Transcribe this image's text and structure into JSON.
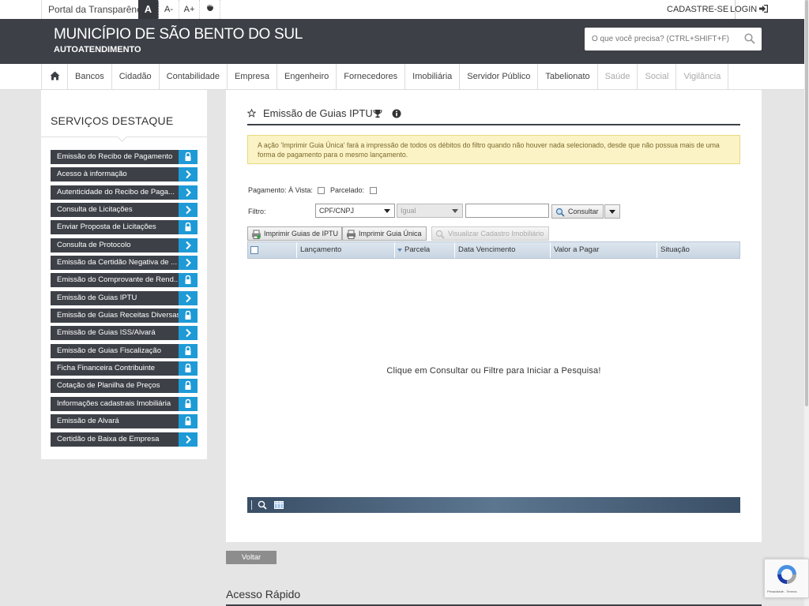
{
  "topbar": {
    "portal_label": "Portal da Transparência",
    "font_normal": "A",
    "font_decrease": "A-",
    "font_increase": "A+",
    "signup_label": "CADASTRE-SE",
    "login_label": "LOGIN"
  },
  "header": {
    "title": "MUNICÍPIO DE SÃO BENTO DO SUL",
    "subtitle": "AUTOATENDIMENTO",
    "search_placeholder": "O que você precisa? (CTRL+SHIFT+F)"
  },
  "nav": {
    "items": [
      {
        "label": "Bancos",
        "enabled": true
      },
      {
        "label": "Cidadão",
        "enabled": true
      },
      {
        "label": "Contabilidade",
        "enabled": true
      },
      {
        "label": "Empresa",
        "enabled": true
      },
      {
        "label": "Engenheiro",
        "enabled": true
      },
      {
        "label": "Fornecedores",
        "enabled": true
      },
      {
        "label": "Imobiliária",
        "enabled": true
      },
      {
        "label": "Servidor Público",
        "enabled": true
      },
      {
        "label": "Tabelionato",
        "enabled": true
      },
      {
        "label": "Saúde",
        "enabled": false
      },
      {
        "label": "Social",
        "enabled": false
      },
      {
        "label": "Vigilância",
        "enabled": false
      }
    ]
  },
  "sidebar": {
    "title": "SERVIÇOS DESTAQUE",
    "items": [
      {
        "label": "Emissão do Recibo de Pagamento",
        "icon": "lock-icon"
      },
      {
        "label": "Acesso à informação",
        "icon": "chevron-right-icon"
      },
      {
        "label": "Autenticidade do Recibo de Paga...",
        "icon": "chevron-right-icon"
      },
      {
        "label": "Consulta de Licitações",
        "icon": "chevron-right-icon"
      },
      {
        "label": "Enviar Proposta de Licitações",
        "icon": "lock-icon"
      },
      {
        "label": "Consulta de Protocolo",
        "icon": "chevron-right-icon"
      },
      {
        "label": "Emissão da Certidão Negativa de ...",
        "icon": "chevron-right-icon"
      },
      {
        "label": "Emissão do Comprovante de Rend...",
        "icon": "lock-icon"
      },
      {
        "label": "Emissão de Guias IPTU",
        "icon": "chevron-right-icon"
      },
      {
        "label": "Emissão de Guias Receitas Diversas",
        "icon": "lock-icon"
      },
      {
        "label": "Emissão de Guias ISS/Alvará",
        "icon": "chevron-right-icon"
      },
      {
        "label": "Emissão de Guias Fiscalização",
        "icon": "lock-icon"
      },
      {
        "label": "Ficha Financeira Contribuinte",
        "icon": "lock-icon"
      },
      {
        "label": "Cotação de Planilha de Preços",
        "icon": "lock-icon"
      },
      {
        "label": "Informações cadastrais Imobiliária",
        "icon": "lock-icon"
      },
      {
        "label": "Emissão de Alvará",
        "icon": "lock-icon"
      },
      {
        "label": "Certidão de Baixa de Empresa",
        "icon": "chevron-right-icon"
      }
    ]
  },
  "main": {
    "page_title": "Emissão de Guias IPTU",
    "alert_text": "A ação 'Imprimir Guia Única' fará a impressão de todos os débitos do filtro quando não houver nada selecionado, desde que não possua mais de uma forma de pagamento para o mesmo lançamento.",
    "payment_label": "Pagamento:",
    "avista_label": "À Vista:",
    "parcelado_label": "Parcelado:",
    "filter_label": "Filtro:",
    "filter_field": "CPF/CNPJ",
    "filter_operator": "Igual",
    "filter_value": "",
    "consult_button": "Consultar",
    "print_iptu_button": "Imprimir Guias de IPTU",
    "print_single_button": "Imprimir Guia Única",
    "view_cadastro_button": "Visualizar Cadastro Imobiliário",
    "grid_columns": [
      "Lançamento",
      "Parcela",
      "Data Vencimento",
      "Valor a Pagar",
      "Situação"
    ],
    "grid_empty_message": "Clique em Consultar ou Filtre para Iniciar a Pesquisa!"
  },
  "footer": {
    "back_button": "Voltar",
    "quick_access_title": "Acesso Rápido",
    "recaptcha_text": "Privacidade - Termos"
  },
  "colors": {
    "header_bg": "#3d4047",
    "accent_blue": "#1e9ad6",
    "alert_bg": "#fbf3c6"
  }
}
